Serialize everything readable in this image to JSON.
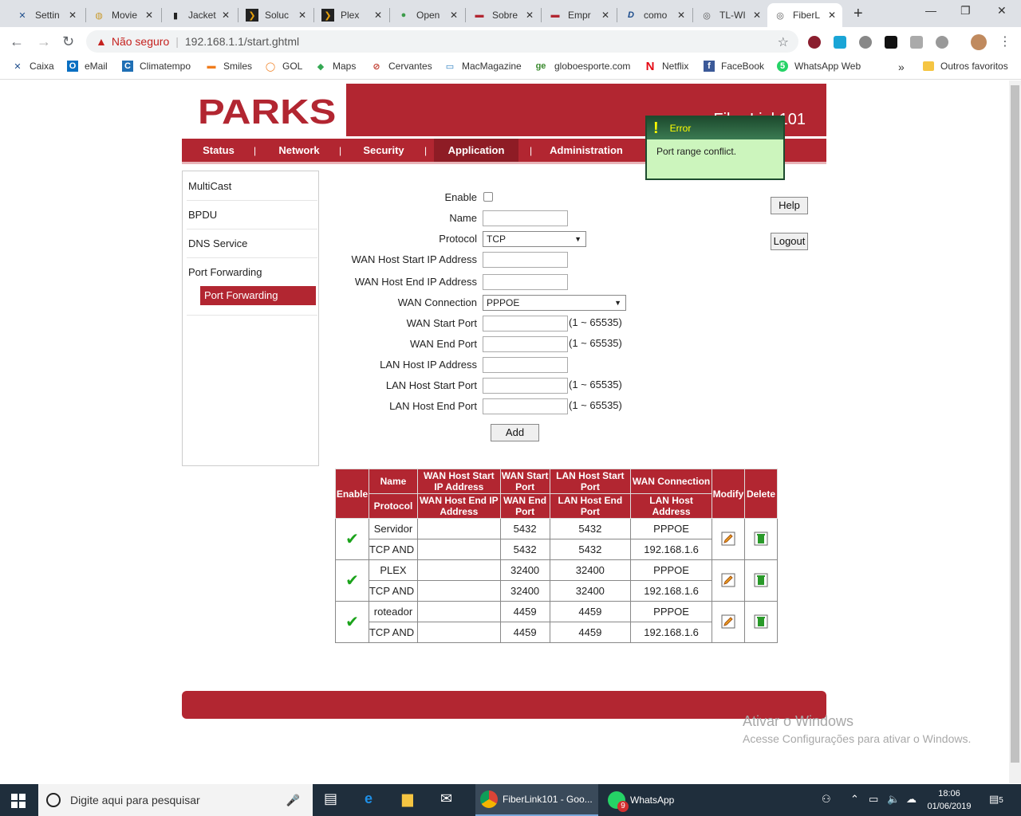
{
  "browser": {
    "tabs": [
      {
        "label": "Settin",
        "icon": "✕",
        "color": "#1f4e8c"
      },
      {
        "label": "Movie",
        "icon": "◍",
        "color": "#c99b2e"
      },
      {
        "label": "Jacket",
        "icon": "▮",
        "color": "#222"
      },
      {
        "label": "Soluc",
        "icon": "❯",
        "color": "#e5a00d"
      },
      {
        "label": "Plex",
        "icon": "❯",
        "color": "#e5a00d"
      },
      {
        "label": "Open",
        "icon": "●",
        "color": "#3c9b4a"
      },
      {
        "label": "Sobre",
        "icon": "▬",
        "color": "#b22631"
      },
      {
        "label": "Empr",
        "icon": "▬",
        "color": "#b22631"
      },
      {
        "label": "como",
        "icon": "D",
        "color": "#1a4a8a"
      },
      {
        "label": "TL-WI",
        "icon": "◎",
        "color": "#555"
      },
      {
        "label": "FiberL",
        "icon": "◎",
        "color": "#555"
      }
    ],
    "new_tab": "+",
    "window_controls": [
      "—",
      "❐",
      "✕"
    ],
    "not_secure": "Não seguro",
    "url": "192.168.1.1/start.ghtml",
    "bookmarks": [
      {
        "label": "Caixa",
        "icon": "✕",
        "color": "#1f4e8c"
      },
      {
        "label": "eMail",
        "icon": "O",
        "color": "#0a6fc2"
      },
      {
        "label": "Climatempo",
        "icon": "C",
        "color": "#1f6fb5"
      },
      {
        "label": "Smiles",
        "icon": "▬",
        "color": "#f07c1c"
      },
      {
        "label": "GOL",
        "icon": "◯",
        "color": "#f07c1c"
      },
      {
        "label": "Maps",
        "icon": "◆",
        "color": "#34a853"
      },
      {
        "label": "Cervantes",
        "icon": "⊘",
        "color": "#c0392b"
      },
      {
        "label": "MacMagazine",
        "icon": "▭",
        "color": "#2d7fc1"
      },
      {
        "label": "globoesporte.com",
        "icon": "ge",
        "color": "#3a8a2e"
      },
      {
        "label": "Netflix",
        "icon": "N",
        "color": "#e50914"
      },
      {
        "label": "FaceBook",
        "icon": "f",
        "color": "#3b5998"
      },
      {
        "label": "WhatsApp Web",
        "icon": "5",
        "color": "#25d366"
      }
    ],
    "more_bookmarks": "»",
    "other_bookmarks": "Outros favoritos"
  },
  "router": {
    "brand": "PARKS",
    "model": "FiberLink101",
    "menu": [
      "Status",
      "Network",
      "Security",
      "Application",
      "Administration"
    ],
    "menu_active": "Application",
    "sidebar": [
      "MultiCast",
      "BPDU",
      "DNS Service",
      "Port Forwarding"
    ],
    "sidebar_sub": "Port Forwarding",
    "form": {
      "enable_label": "Enable",
      "name_label": "Name",
      "protocol_label": "Protocol",
      "protocol_value": "TCP",
      "wan_start_ip_label": "WAN Host Start IP Address",
      "wan_end_ip_label": "WAN Host End IP Address",
      "wan_connection_label": "WAN Connection",
      "wan_connection_value": "PPPOE",
      "wan_start_port_label": "WAN Start Port",
      "wan_end_port_label": "WAN End Port",
      "lan_ip_label": "LAN Host IP Address",
      "lan_start_port_label": "LAN Host Start Port",
      "lan_end_port_label": "LAN Host End Port",
      "range_hint": "(1 ~ 65535)",
      "add_button": "Add"
    },
    "help_button": "Help",
    "logout_button": "Logout",
    "table": {
      "headers": {
        "enable": "Enable",
        "name": "Name",
        "protocol": "Protocol",
        "wan_start_ip": "WAN Host Start IP Address",
        "wan_end_ip": "WAN Host End IP Address",
        "wan_start_port": "WAN Start Port",
        "wan_end_port": "WAN End Port",
        "lan_start_port": "LAN Host Start Port",
        "lan_end_port": "LAN Host End Port",
        "wan_connection": "WAN Connection",
        "lan_address": "LAN Host Address",
        "modify": "Modify",
        "delete": "Delete"
      },
      "rows": [
        {
          "name": "Servidor",
          "protocol": "TCP AND UDP",
          "wan_start_port": "5432",
          "lan_start_port": "5432",
          "wan_end_port": "5432",
          "lan_end_port": "5432",
          "wan_connection": "PPPOE",
          "lan_address": "192.168.1.6"
        },
        {
          "name": "PLEX",
          "protocol": "TCP AND UDP",
          "wan_start_port": "32400",
          "lan_start_port": "32400",
          "wan_end_port": "32400",
          "lan_end_port": "32400",
          "wan_connection": "PPPOE",
          "lan_address": "192.168.1.6"
        },
        {
          "name": "roteador",
          "protocol": "TCP AND UDP",
          "wan_start_port": "4459",
          "lan_start_port": "4459",
          "wan_end_port": "4459",
          "lan_end_port": "4459",
          "wan_connection": "PPPOE",
          "lan_address": "192.168.1.6"
        }
      ]
    },
    "error": {
      "title": "Error",
      "message": "Port range conflict."
    }
  },
  "watermark": {
    "line1": "Ativar o Windows",
    "line2": "Acesse Configurações para ativar o Windows."
  },
  "taskbar": {
    "search_placeholder": "Digite aqui para pesquisar",
    "apps": [
      {
        "label": "FiberLink101 - Goo...",
        "color": "#4285f4"
      },
      {
        "label": "WhatsApp",
        "color": "#25d366",
        "badge": "9"
      }
    ],
    "time": "18:06",
    "date": "01/06/2019",
    "notifications": "5"
  }
}
